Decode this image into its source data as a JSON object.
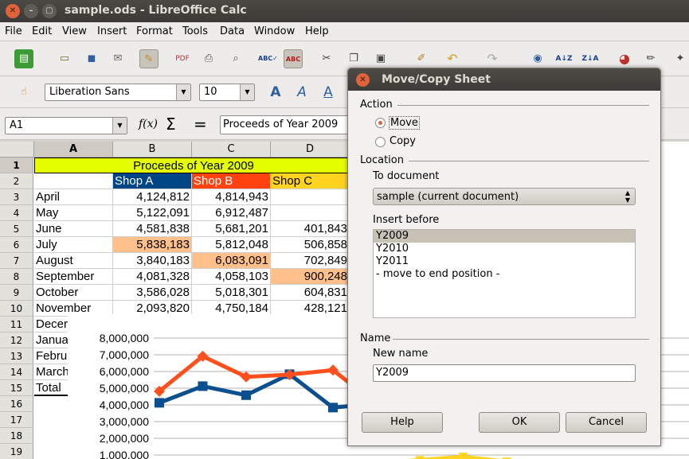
{
  "window": {
    "title": "sample.ods - LibreOffice Calc"
  },
  "menu": [
    "File",
    "Edit",
    "View",
    "Insert",
    "Format",
    "Tools",
    "Data",
    "Window",
    "Help"
  ],
  "formatting": {
    "font_name": "Liberation Sans",
    "font_size": "10"
  },
  "formula_bar": {
    "cell_ref": "A1",
    "content": "Proceeds of Year 2009"
  },
  "sheet": {
    "columns": [
      "A",
      "B",
      "C",
      "D"
    ],
    "rows": [
      "1",
      "2",
      "3",
      "4",
      "5",
      "6",
      "7",
      "8",
      "9",
      "10",
      "11",
      "12",
      "13",
      "14",
      "15",
      "16",
      "17",
      "18",
      "19"
    ],
    "title": "Proceeds of Year 2009",
    "shops": [
      "Shop A",
      "Shop B",
      "Shop C"
    ],
    "data": [
      [
        "April",
        "4,124,812",
        "4,814,943",
        ""
      ],
      [
        "May",
        "5,122,091",
        "6,912,487",
        ""
      ],
      [
        "June",
        "4,581,838",
        "5,681,201",
        "401,843"
      ],
      [
        "July",
        "5,838,183",
        "5,812,048",
        "506,858"
      ],
      [
        "August",
        "3,840,183",
        "6,083,091",
        "702,849"
      ],
      [
        "September",
        "4,081,328",
        "4,058,103",
        "900,248"
      ],
      [
        "October",
        "3,586,028",
        "5,018,301",
        "604,831"
      ],
      [
        "November",
        "2,093,820",
        "4,750,184",
        "428,121"
      ],
      [
        "Decer",
        "",
        "",
        ""
      ],
      [
        "Janua",
        "",
        "",
        ""
      ],
      [
        "Febru",
        "",
        "",
        ""
      ],
      [
        "March",
        "",
        "",
        ""
      ],
      [
        "Total",
        "",
        "",
        ""
      ]
    ]
  },
  "chart_data": {
    "type": "line",
    "yticks": [
      "8,000,000",
      "7,000,000",
      "6,000,000",
      "5,000,000",
      "4,000,000",
      "3,000,000",
      "2,000,000",
      "1,000,000"
    ],
    "ylim": [
      0,
      8000000
    ],
    "series": [
      {
        "color": "#0b4f8e",
        "values": [
          4124812,
          5122091,
          4581838,
          5838183,
          3840183,
          4081328
        ]
      },
      {
        "color": "#ff4f1c",
        "values": [
          4814943,
          6912487,
          5681201,
          5812048,
          6083091,
          4058103
        ]
      },
      {
        "color": "#ffd320",
        "values": [
          100000,
          130000,
          200000,
          290000,
          401843,
          506858,
          702849,
          900248,
          604831,
          428121,
          300000,
          250000,
          220000,
          200000,
          180000
        ]
      }
    ]
  },
  "dialog": {
    "title": "Move/Copy Sheet",
    "action_label": "Action",
    "move_label": "Move",
    "copy_label": "Copy",
    "location_label": "Location",
    "to_document_label": "To document",
    "to_document_value": "sample (current document)",
    "insert_before_label": "Insert before",
    "insert_before_items": [
      "Y2009",
      "Y2010",
      "Y2011",
      "- move to end position -"
    ],
    "name_label": "Name",
    "new_name_label": "New name",
    "new_name_value": "Y2009",
    "help_label": "Help",
    "ok_label": "OK",
    "cancel_label": "Cancel"
  }
}
